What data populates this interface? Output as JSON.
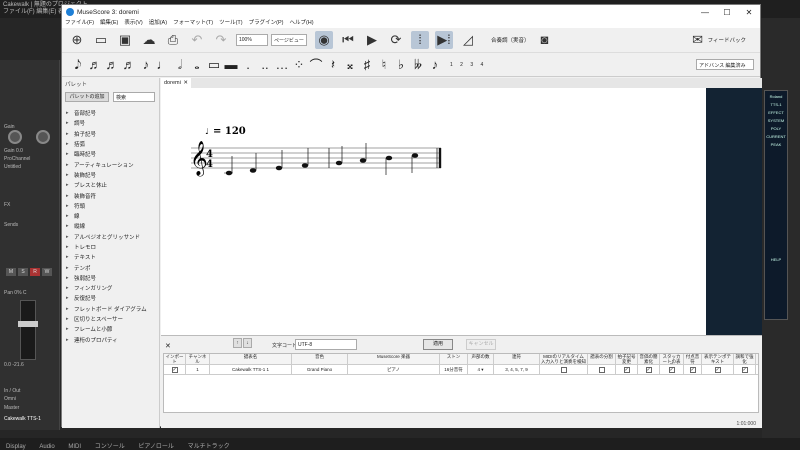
{
  "daw": {
    "title_line1": "Cakewalk | 無題のプロジェクト",
    "title_line2": "ファイル(F)  編集(E)  表示(V)",
    "strip_labels": [
      "Gain",
      "Gain 0.0",
      "ProChannel",
      "Untitled",
      "FX",
      "Sends",
      "Pan 0% C",
      "0.0  -21.6",
      "In / Out",
      "Omni",
      "Master",
      "Cakewalk TTS-1"
    ],
    "strip_buttons": [
      "M",
      "S",
      "R",
      "W"
    ],
    "bottom_tabs": [
      "Display",
      "Audio",
      "MIDI",
      "コンソール",
      "ピアノロール",
      "マルチトラック"
    ]
  },
  "plugin": {
    "items": [
      "Roland",
      "TTS-1",
      "EFFECT",
      "SYSTEM",
      "POLY",
      "CURRENT",
      "PEAK",
      "HELP"
    ]
  },
  "window": {
    "title": "MuseScore 3: doremi",
    "controls": [
      "—",
      "☐",
      "✕"
    ]
  },
  "menu": [
    "ファイル(F)",
    "編集(E)",
    "表示(V)",
    "追加(A)",
    "フォーマット(T)",
    "ツール(T)",
    "プラグイン(P)",
    "ヘルプ(H)"
  ],
  "toolbar": {
    "zoom": "100%",
    "view_mode": "ページビュー",
    "concert_pitch": "合奏調（実音）",
    "feedback": "フィードバック"
  },
  "notebar": {
    "voices": "1 2 3 4",
    "advanced": "アドバンス 編集済み"
  },
  "palette": {
    "header": "パレット",
    "add_palette": "パレットの追加",
    "search_placeholder": "検索",
    "items": [
      "音部記号",
      "調号",
      "拍子記号",
      "括弧",
      "臨時記号",
      "アーティキュレーション",
      "装飾記号",
      "ブレスと休止",
      "装飾音符",
      "符頭",
      "線",
      "縦線",
      "アルペジオとグリッサンド",
      "トレモロ",
      "テキスト",
      "テンポ",
      "強弱記号",
      "フィンガリング",
      "反復記号",
      "フレットボード ダイアグラム",
      "区切りとスペーサー",
      "フレームと小節",
      "連桁のプロパティ"
    ]
  },
  "score": {
    "tab_name": "doremi",
    "tempo_text": "= 120",
    "time_signature": [
      "4",
      "4"
    ]
  },
  "midi_panel": {
    "close": "✕",
    "charset_label": "文字コード",
    "charset_value": "UTF-8",
    "apply": "適用",
    "cancel": "キャンセル",
    "headers": [
      "インポート",
      "チャンネル",
      "譜表名",
      "音色",
      "MuseScore 楽器",
      "ストン",
      "声部の数",
      "連符",
      "MIDIのリアルタイム入力入りと演奏を検知",
      "譜表の分割",
      "拍子記号変更",
      "音価の簡素化",
      "スタッカートの表示",
      "付点音符",
      "表示テンポテキスト",
      "調和で強化"
    ],
    "row": {
      "channel": "1",
      "staff_name": "Cakewalk TTS-1 1",
      "sound": "Grand Piano",
      "instrument": "ピアノ",
      "quantize": "16分音符",
      "voices": "4 ▾",
      "tuplets": "3, 4, 5, 7, 9"
    },
    "status": "1:01:000"
  }
}
